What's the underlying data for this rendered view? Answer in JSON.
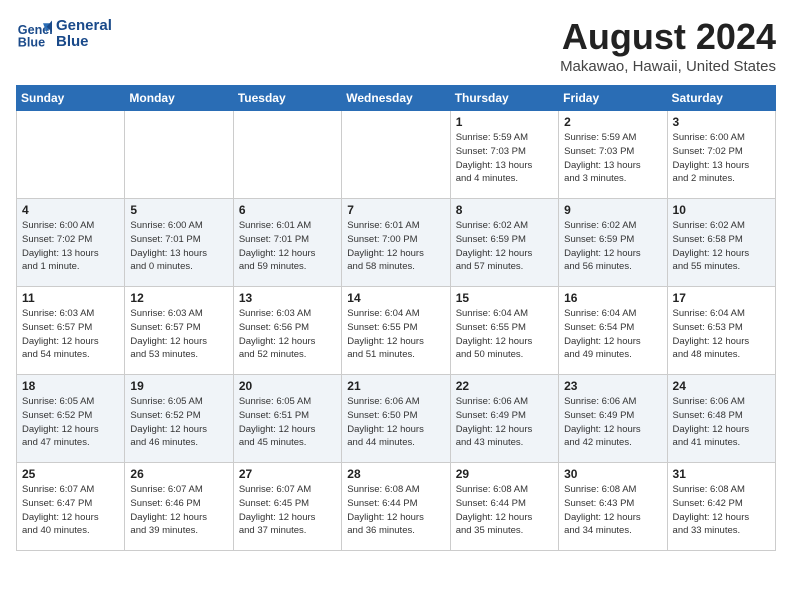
{
  "header": {
    "logo_line1": "General",
    "logo_line2": "Blue",
    "month_year": "August 2024",
    "location": "Makawao, Hawaii, United States"
  },
  "weekdays": [
    "Sunday",
    "Monday",
    "Tuesday",
    "Wednesday",
    "Thursday",
    "Friday",
    "Saturday"
  ],
  "weeks": [
    [
      {
        "day": "",
        "info": ""
      },
      {
        "day": "",
        "info": ""
      },
      {
        "day": "",
        "info": ""
      },
      {
        "day": "",
        "info": ""
      },
      {
        "day": "1",
        "info": "Sunrise: 5:59 AM\nSunset: 7:03 PM\nDaylight: 13 hours\nand 4 minutes."
      },
      {
        "day": "2",
        "info": "Sunrise: 5:59 AM\nSunset: 7:03 PM\nDaylight: 13 hours\nand 3 minutes."
      },
      {
        "day": "3",
        "info": "Sunrise: 6:00 AM\nSunset: 7:02 PM\nDaylight: 13 hours\nand 2 minutes."
      }
    ],
    [
      {
        "day": "4",
        "info": "Sunrise: 6:00 AM\nSunset: 7:02 PM\nDaylight: 13 hours\nand 1 minute."
      },
      {
        "day": "5",
        "info": "Sunrise: 6:00 AM\nSunset: 7:01 PM\nDaylight: 13 hours\nand 0 minutes."
      },
      {
        "day": "6",
        "info": "Sunrise: 6:01 AM\nSunset: 7:01 PM\nDaylight: 12 hours\nand 59 minutes."
      },
      {
        "day": "7",
        "info": "Sunrise: 6:01 AM\nSunset: 7:00 PM\nDaylight: 12 hours\nand 58 minutes."
      },
      {
        "day": "8",
        "info": "Sunrise: 6:02 AM\nSunset: 6:59 PM\nDaylight: 12 hours\nand 57 minutes."
      },
      {
        "day": "9",
        "info": "Sunrise: 6:02 AM\nSunset: 6:59 PM\nDaylight: 12 hours\nand 56 minutes."
      },
      {
        "day": "10",
        "info": "Sunrise: 6:02 AM\nSunset: 6:58 PM\nDaylight: 12 hours\nand 55 minutes."
      }
    ],
    [
      {
        "day": "11",
        "info": "Sunrise: 6:03 AM\nSunset: 6:57 PM\nDaylight: 12 hours\nand 54 minutes."
      },
      {
        "day": "12",
        "info": "Sunrise: 6:03 AM\nSunset: 6:57 PM\nDaylight: 12 hours\nand 53 minutes."
      },
      {
        "day": "13",
        "info": "Sunrise: 6:03 AM\nSunset: 6:56 PM\nDaylight: 12 hours\nand 52 minutes."
      },
      {
        "day": "14",
        "info": "Sunrise: 6:04 AM\nSunset: 6:55 PM\nDaylight: 12 hours\nand 51 minutes."
      },
      {
        "day": "15",
        "info": "Sunrise: 6:04 AM\nSunset: 6:55 PM\nDaylight: 12 hours\nand 50 minutes."
      },
      {
        "day": "16",
        "info": "Sunrise: 6:04 AM\nSunset: 6:54 PM\nDaylight: 12 hours\nand 49 minutes."
      },
      {
        "day": "17",
        "info": "Sunrise: 6:04 AM\nSunset: 6:53 PM\nDaylight: 12 hours\nand 48 minutes."
      }
    ],
    [
      {
        "day": "18",
        "info": "Sunrise: 6:05 AM\nSunset: 6:52 PM\nDaylight: 12 hours\nand 47 minutes."
      },
      {
        "day": "19",
        "info": "Sunrise: 6:05 AM\nSunset: 6:52 PM\nDaylight: 12 hours\nand 46 minutes."
      },
      {
        "day": "20",
        "info": "Sunrise: 6:05 AM\nSunset: 6:51 PM\nDaylight: 12 hours\nand 45 minutes."
      },
      {
        "day": "21",
        "info": "Sunrise: 6:06 AM\nSunset: 6:50 PM\nDaylight: 12 hours\nand 44 minutes."
      },
      {
        "day": "22",
        "info": "Sunrise: 6:06 AM\nSunset: 6:49 PM\nDaylight: 12 hours\nand 43 minutes."
      },
      {
        "day": "23",
        "info": "Sunrise: 6:06 AM\nSunset: 6:49 PM\nDaylight: 12 hours\nand 42 minutes."
      },
      {
        "day": "24",
        "info": "Sunrise: 6:06 AM\nSunset: 6:48 PM\nDaylight: 12 hours\nand 41 minutes."
      }
    ],
    [
      {
        "day": "25",
        "info": "Sunrise: 6:07 AM\nSunset: 6:47 PM\nDaylight: 12 hours\nand 40 minutes."
      },
      {
        "day": "26",
        "info": "Sunrise: 6:07 AM\nSunset: 6:46 PM\nDaylight: 12 hours\nand 39 minutes."
      },
      {
        "day": "27",
        "info": "Sunrise: 6:07 AM\nSunset: 6:45 PM\nDaylight: 12 hours\nand 37 minutes."
      },
      {
        "day": "28",
        "info": "Sunrise: 6:08 AM\nSunset: 6:44 PM\nDaylight: 12 hours\nand 36 minutes."
      },
      {
        "day": "29",
        "info": "Sunrise: 6:08 AM\nSunset: 6:44 PM\nDaylight: 12 hours\nand 35 minutes."
      },
      {
        "day": "30",
        "info": "Sunrise: 6:08 AM\nSunset: 6:43 PM\nDaylight: 12 hours\nand 34 minutes."
      },
      {
        "day": "31",
        "info": "Sunrise: 6:08 AM\nSunset: 6:42 PM\nDaylight: 12 hours\nand 33 minutes."
      }
    ]
  ]
}
